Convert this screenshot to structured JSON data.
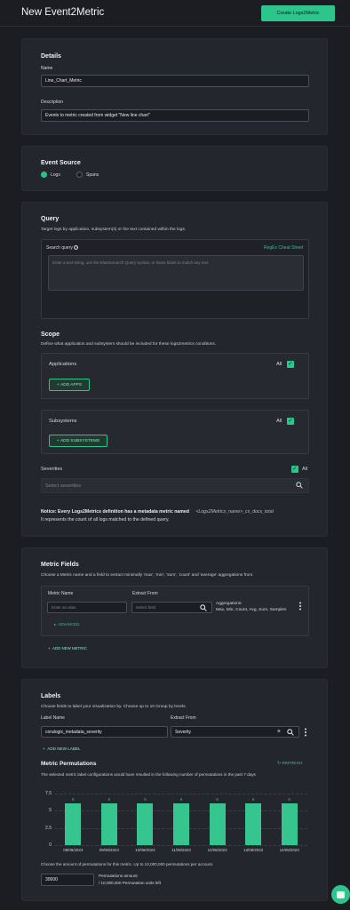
{
  "header": {
    "title": "New Event2Metric",
    "create_label": "Create Logs2Metric"
  },
  "details": {
    "title": "Details",
    "name_label": "Name",
    "name_value": "Line_Chart_Metric",
    "description_label": "Description",
    "description_value": "Events to metric created from widget \"New line chart\""
  },
  "event_source": {
    "title": "Event Source",
    "options": [
      "Logs",
      "Spans"
    ],
    "selected": "Logs"
  },
  "query": {
    "title": "Query",
    "subtitle": "Target logs by application, subsystem(s) or the text contained within the logs.",
    "search_label": "Search query",
    "regex_link": "RegEx Cheat Sheet",
    "placeholder": "Enter a text string, use the Elasticsearch Query Syntax, or leave blank to match any text"
  },
  "scope": {
    "title": "Scope",
    "subtitle": "Define what application and subsystem should be included for these logs2metrics conditions.",
    "applications_label": "Applications",
    "add_apps": "ADD APPS",
    "subsystems_label": "Subsystems",
    "add_subsystems": "ADD SUBSYSTEMS",
    "all_label": "All",
    "severities_label": "Severities",
    "severities_placeholder": "Select severities"
  },
  "notice": {
    "line1": "Notice: Every Logs2Metrics definition has a metadata metric named",
    "metric_name": "<Logs2Metrics_name>_cx_docs_total",
    "line2": "It represents the count of all logs matched to the defined query."
  },
  "metric_fields": {
    "title": "Metric Fields",
    "subtitle": "Choose a Metric name and a field to extract minimally 'max', 'min', 'sum', 'count' and 'average' aggregations from.",
    "metric_name_label": "Metric Name",
    "metric_name_placeholder": "Enter an alias",
    "extract_from_label": "Extract From",
    "extract_placeholder": "Select field",
    "aggregations_label": "Aggregations:",
    "aggregations_value": "Max, Min, Count, Avg, Sum, Samples",
    "advanced_label": "ADVANCED",
    "add_new_metric": "ADD NEW METRIC"
  },
  "labels": {
    "title": "Labels",
    "subtitle": "Choose fields to label your visualization by. Choose up to 10 Group by levels.",
    "label_name_header": "Label Name",
    "extract_from_header": "Extract From",
    "label_name_value": "coralogix_metadata_severity",
    "extract_value": "Severity",
    "add_new_label": "ADD NEW LABEL"
  },
  "permutations": {
    "title": "Metric Permutations",
    "refresh_label": "REFRESH",
    "subtitle": "The selected metric label configurations would have resulted in the following number of permutations in the past 7 days",
    "amount_prompt": "Choose the amount of permutations for this metric. Up to 10,000,000 permutations per account.",
    "amount_value": "30000",
    "amount_label": "Permutations amount",
    "units_left": "/ 10,000,000 Permutation units left"
  },
  "chart_data": {
    "type": "bar",
    "categories": [
      "08/08/2023",
      "09/08/2023",
      "10/08/2023",
      "11/08/2023",
      "12/08/2023",
      "13/08/2023",
      "14/08/2023"
    ],
    "values": [
      6,
      6,
      6,
      6,
      6,
      6,
      6
    ],
    "yticks": [
      "7.5",
      "5",
      "2.5",
      "0"
    ],
    "ylim": [
      0,
      8.5
    ],
    "color": "#36c58f"
  }
}
